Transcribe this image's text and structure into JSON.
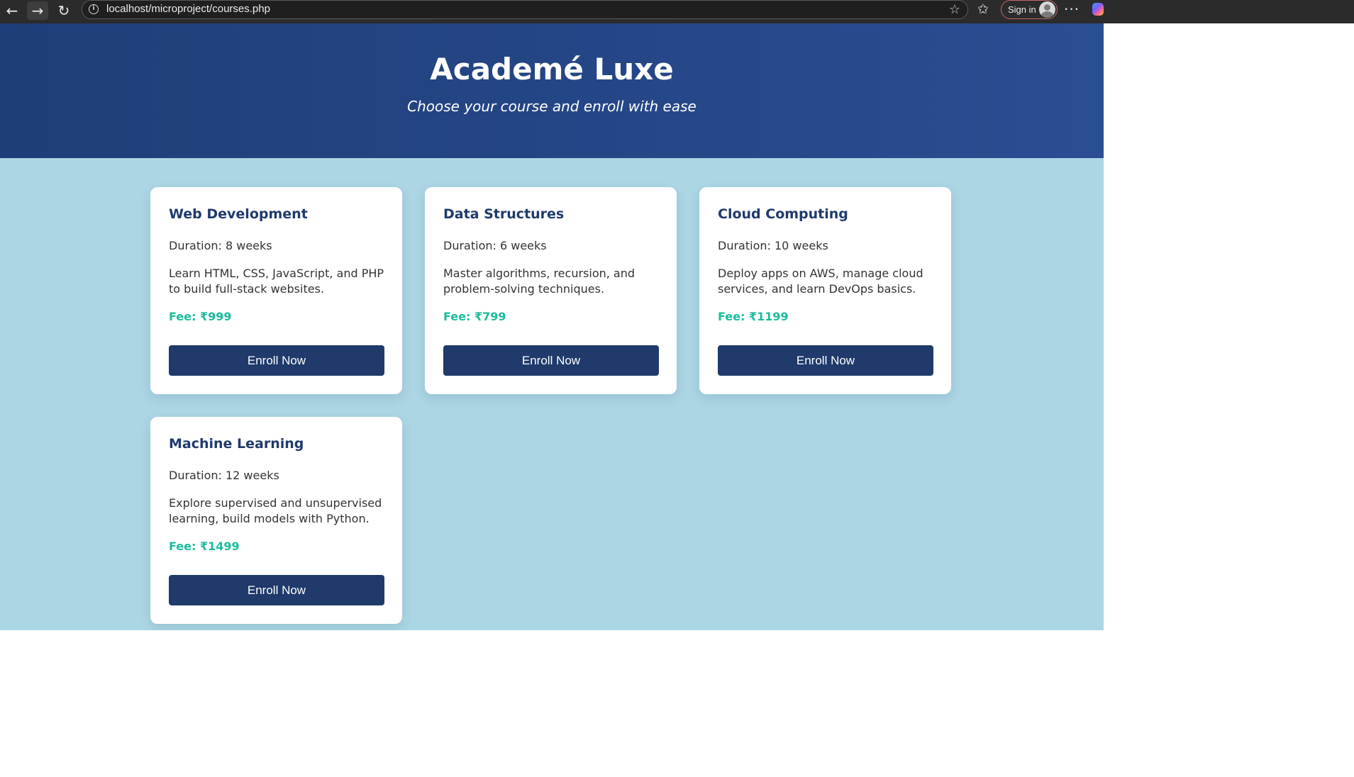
{
  "browser": {
    "url": "localhost/microproject/courses.php",
    "sign_in_label": "Sign in",
    "icons": [
      "back-arrow-icon",
      "forward-arrow-icon",
      "reload-icon",
      "info-icon",
      "star-icon",
      "favorites-icon",
      "avatar-icon",
      "more-icon",
      "copilot-icon"
    ]
  },
  "hero": {
    "title": "Academé Luxe",
    "subtitle": "Choose your course and enroll with ease"
  },
  "colors": {
    "hero_bg": "#254a8a",
    "page_bg": "#acd6e4",
    "card_title": "#1f3a6b",
    "fee": "#1abc9c",
    "button_bg": "#1f3a6b"
  },
  "courses": [
    {
      "title": "Web Development",
      "duration": "Duration: 8 weeks",
      "description": "Learn HTML, CSS, JavaScript, and PHP to build full-stack websites.",
      "fee": "Fee: ₹999",
      "button": "Enroll Now"
    },
    {
      "title": "Data Structures",
      "duration": "Duration: 6 weeks",
      "description": "Master algorithms, recursion, and problem-solving techniques.",
      "fee": "Fee: ₹799",
      "button": "Enroll Now"
    },
    {
      "title": "Cloud Computing",
      "duration": "Duration: 10 weeks",
      "description": "Deploy apps on AWS, manage cloud services, and learn DevOps basics.",
      "fee": "Fee: ₹1199",
      "button": "Enroll Now"
    },
    {
      "title": "Machine Learning",
      "duration": "Duration: 12 weeks",
      "description": "Explore supervised and unsupervised learning, build models with Python.",
      "fee": "Fee: ₹1499",
      "button": "Enroll Now"
    }
  ]
}
